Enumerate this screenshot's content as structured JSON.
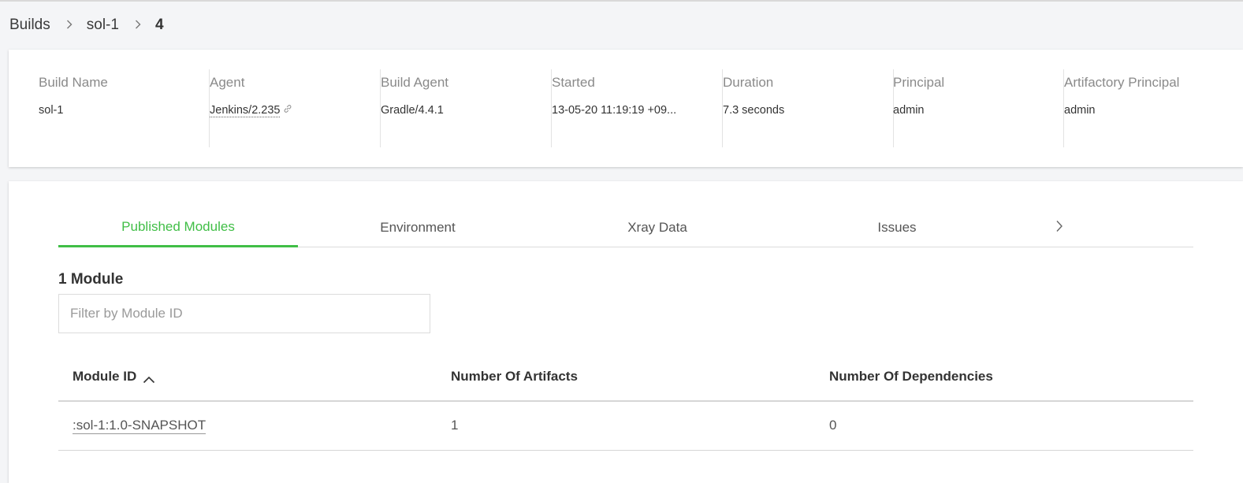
{
  "breadcrumb": {
    "items": [
      "Builds",
      "sol-1"
    ],
    "current": "4",
    "separator": "›"
  },
  "info": [
    {
      "label": "Build Name",
      "value": "sol-1"
    },
    {
      "label": "Agent",
      "value": "Jenkins/2.235"
    },
    {
      "label": "Build Agent",
      "value": "Gradle/4.4.1"
    },
    {
      "label": "Started",
      "value": "13-05-20 11:19:19 +09..."
    },
    {
      "label": "Duration",
      "value": "7.3 seconds"
    },
    {
      "label": "Principal",
      "value": "admin"
    },
    {
      "label": "Artifactory Principal",
      "value": "admin"
    }
  ],
  "tabs": [
    {
      "label": "Published Modules",
      "active": true
    },
    {
      "label": "Environment",
      "active": false
    },
    {
      "label": "Xray Data",
      "active": false
    },
    {
      "label": "Issues",
      "active": false
    }
  ],
  "modules": {
    "count_label": "1 Module",
    "filter_placeholder": "Filter by Module ID",
    "columns": [
      "Module ID",
      "Number Of Artifacts",
      "Number Of Dependencies"
    ],
    "rows": [
      [
        ":sol-1:1.0-SNAPSHOT",
        "1",
        "0"
      ]
    ]
  },
  "colors": {
    "accent": "#40be46",
    "background": "#f4f5f7"
  }
}
